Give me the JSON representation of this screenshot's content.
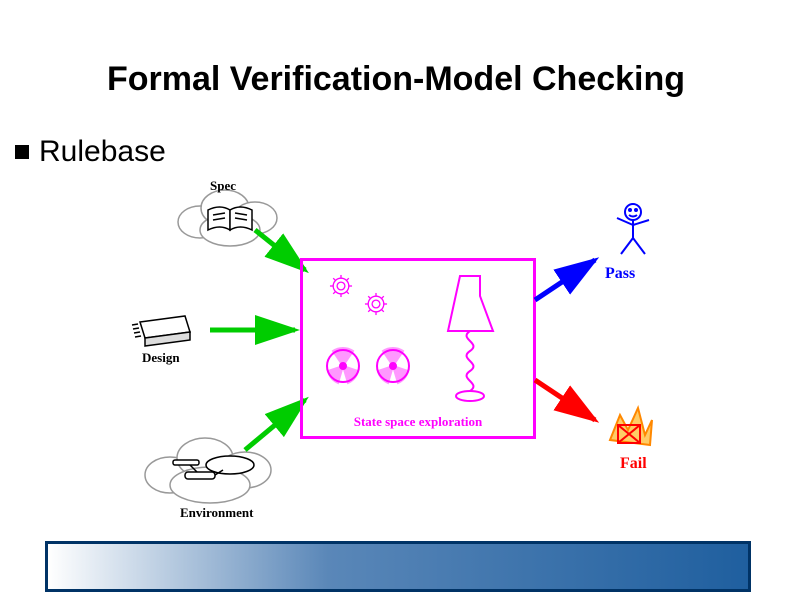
{
  "title": "Formal Verification-Model Checking",
  "bullet1": "Rulebase",
  "diagram": {
    "spec_label": "Spec",
    "design_label": "Design",
    "env_label": "Environment",
    "state_label": "State space exploration",
    "pass_label": "Pass",
    "fail_label": "Fail"
  }
}
